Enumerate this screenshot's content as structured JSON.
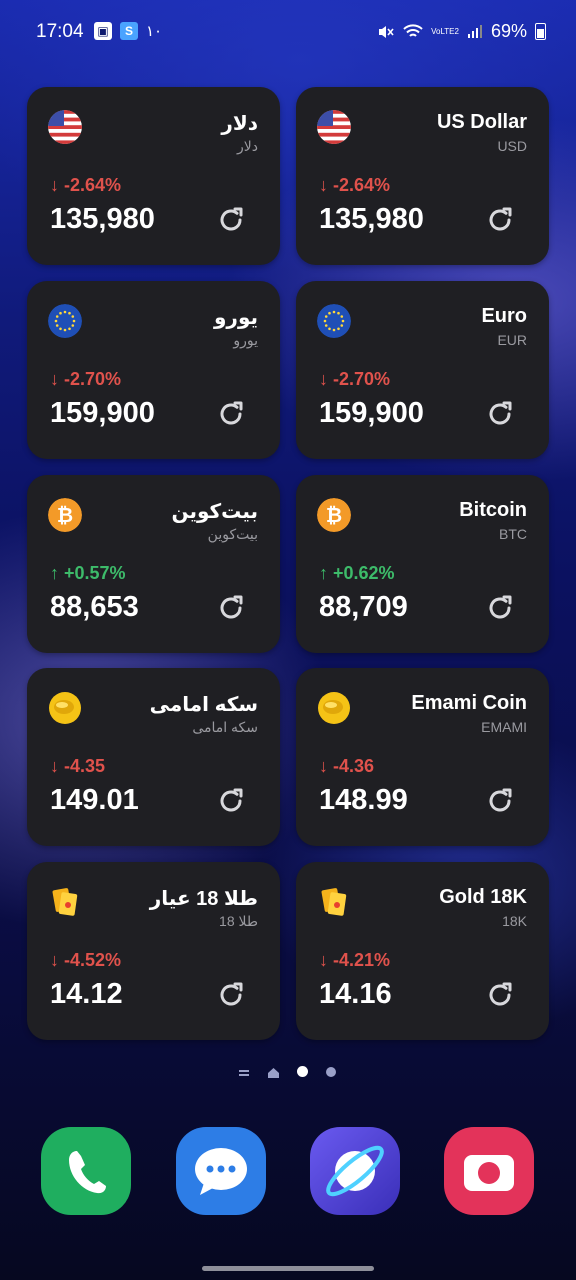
{
  "status_bar": {
    "time": "17:04",
    "notif_count": "١٠",
    "battery": "69%",
    "lte_label": "VoLTE2",
    "icons": [
      "image-icon",
      "s-app-icon",
      "mute-icon",
      "wifi-icon",
      "signal-icon",
      "battery-icon"
    ]
  },
  "cards": [
    {
      "name": "دلار",
      "code": "دلار",
      "change": "-2.64%",
      "direction": "down",
      "value": "135,980",
      "icon": "us-flag-icon"
    },
    {
      "name": "US Dollar",
      "code": "USD",
      "change": "-2.64%",
      "direction": "down",
      "value": "135,980",
      "icon": "us-flag-icon"
    },
    {
      "name": "یورو",
      "code": "یورو",
      "change": "-2.70%",
      "direction": "down",
      "value": "159,900",
      "icon": "eu-flag-icon"
    },
    {
      "name": "Euro",
      "code": "EUR",
      "change": "-2.70%",
      "direction": "down",
      "value": "159,900",
      "icon": "eu-flag-icon"
    },
    {
      "name": "بیت‌کوین",
      "code": "بیت‌کوین",
      "change": "+0.57%",
      "direction": "up",
      "value": "88,653",
      "icon": "bitcoin-icon"
    },
    {
      "name": "Bitcoin",
      "code": "BTC",
      "change": "+0.62%",
      "direction": "up",
      "value": "88,709",
      "icon": "bitcoin-icon"
    },
    {
      "name": "سکه امامی",
      "code": "سکه امامی",
      "change": "-4.35",
      "direction": "down",
      "value": "149.01",
      "icon": "gold-coin-icon"
    },
    {
      "name": "Emami Coin",
      "code": "EMAMI",
      "change": "-4.36",
      "direction": "down",
      "value": "148.99",
      "icon": "gold-coin-icon"
    },
    {
      "name": "طلا 18 عیار",
      "code": "طلا 18",
      "change": "-4.52%",
      "direction": "down",
      "value": "14.12",
      "icon": "gold-bar-icon"
    },
    {
      "name": "Gold 18K",
      "code": "18K",
      "change": "-4.21%",
      "direction": "down",
      "value": "14.16",
      "icon": "gold-bar-icon"
    }
  ],
  "colors": {
    "down": "#e0524c",
    "up": "#3dbb6a",
    "card": "#1f1f23"
  },
  "pager": {
    "active_index": 2,
    "count": 4
  },
  "dock": [
    "phone-icon",
    "messages-icon",
    "internet-browser-icon",
    "camera-icon"
  ]
}
